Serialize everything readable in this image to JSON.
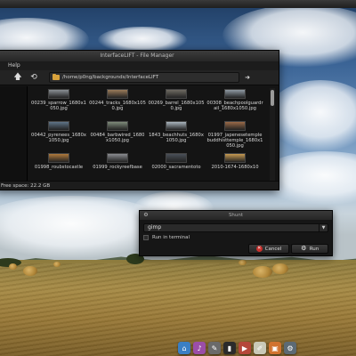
{
  "file_manager": {
    "title": "InterfaceLIFT - File Manager",
    "menu": [
      "Help"
    ],
    "toolbar": {
      "up_icon": "arrow-up-icon",
      "reload_icon": "reload-icon"
    },
    "location": "/home/p0ng/backgrounds/InterfaceLIFT",
    "files": [
      {
        "name": "00239_sparrow_1680x1050.jpg",
        "thumb": "#8a8f94"
      },
      {
        "name": "00244_tracks_1680x1050.jpg",
        "thumb": "#9a7b5a"
      },
      {
        "name": "00269_barrel_1680x1050.jpg",
        "thumb": "#6e6a62"
      },
      {
        "name": "00308_beachpoolguardrail_1680x1050.jpg",
        "thumb": "#8f9aa3"
      },
      {
        "name": "00442_pyrenees_1680x1050.jpg",
        "thumb": "#5f7488"
      },
      {
        "name": "00484_barbwired_1680x1050.jpg",
        "thumb": "#7e8a7a"
      },
      {
        "name": "1843_beachhuts_1680x1050.jpg",
        "thumb": "#a9b4bd"
      },
      {
        "name": "01997_japenesetemplebuddhisttemple_1680x1050.jpg",
        "thumb": "#9a6a48"
      },
      {
        "name": "01998_roubstocastle",
        "thumb": "#b07a3c"
      },
      {
        "name": "01999_rockyreefbase",
        "thumb": "#8a8c90"
      },
      {
        "name": "02000_sacramentoto",
        "thumb": "#4a5058"
      },
      {
        "name": "2010-1674-1680x10",
        "thumb": "#c69a52"
      }
    ],
    "status": "Free space: 22.2 GB"
  },
  "run_dialog": {
    "title": "Shunt",
    "command": "gimp",
    "run_in_terminal_label": "Run in terminal",
    "run_in_terminal_checked": false,
    "cancel_label": "Cancel",
    "run_label": "Run"
  },
  "dock": {
    "items": [
      {
        "name": "home-folder-icon",
        "color": "#3a7fc4"
      },
      {
        "name": "media-player-icon",
        "color": "#9b4ea8"
      },
      {
        "name": "gimp-icon",
        "color": "#6a6a6a"
      },
      {
        "name": "terminal-icon",
        "color": "#2b2b2b"
      },
      {
        "name": "video-icon",
        "color": "#b5473a"
      },
      {
        "name": "text-editor-icon",
        "color": "#c9c9b8"
      },
      {
        "name": "image-viewer-icon",
        "color": "#d1732f"
      },
      {
        "name": "settings-icon",
        "color": "#5c6a74"
      }
    ]
  }
}
